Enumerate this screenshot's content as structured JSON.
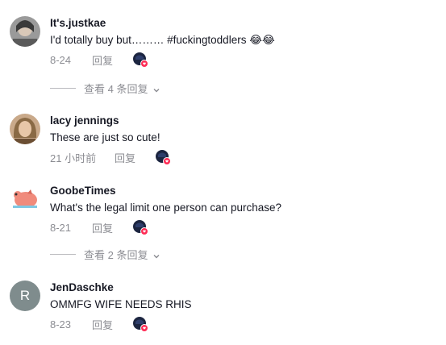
{
  "comments": [
    {
      "username": "It's.justkae",
      "text": "I'd totally buy but……… #fuckingtoddlers 😂😂",
      "time": "8-24",
      "reply_label": "回复",
      "view_replies_label": "查看 4 条回复"
    },
    {
      "username": "lacy jennings",
      "text": "These are just so cute!",
      "time": "21 小时前",
      "reply_label": "回复"
    },
    {
      "username": "GoobeTimes",
      "text": "What's the legal limit one person can purchase?",
      "time": "8-21",
      "reply_label": "回复",
      "view_replies_label": "查看 2 条回复"
    },
    {
      "username": "JenDaschke",
      "avatar_initial": "R",
      "text": "OMMFG WIFE NEEDS RHIS",
      "time": "8-23",
      "reply_label": "回复"
    }
  ],
  "colors": {
    "text_primary": "#161823",
    "text_secondary": "#8a8b91",
    "like_badge": "#fe2c55",
    "avatar_initial_bg": "#7f8c8d"
  }
}
